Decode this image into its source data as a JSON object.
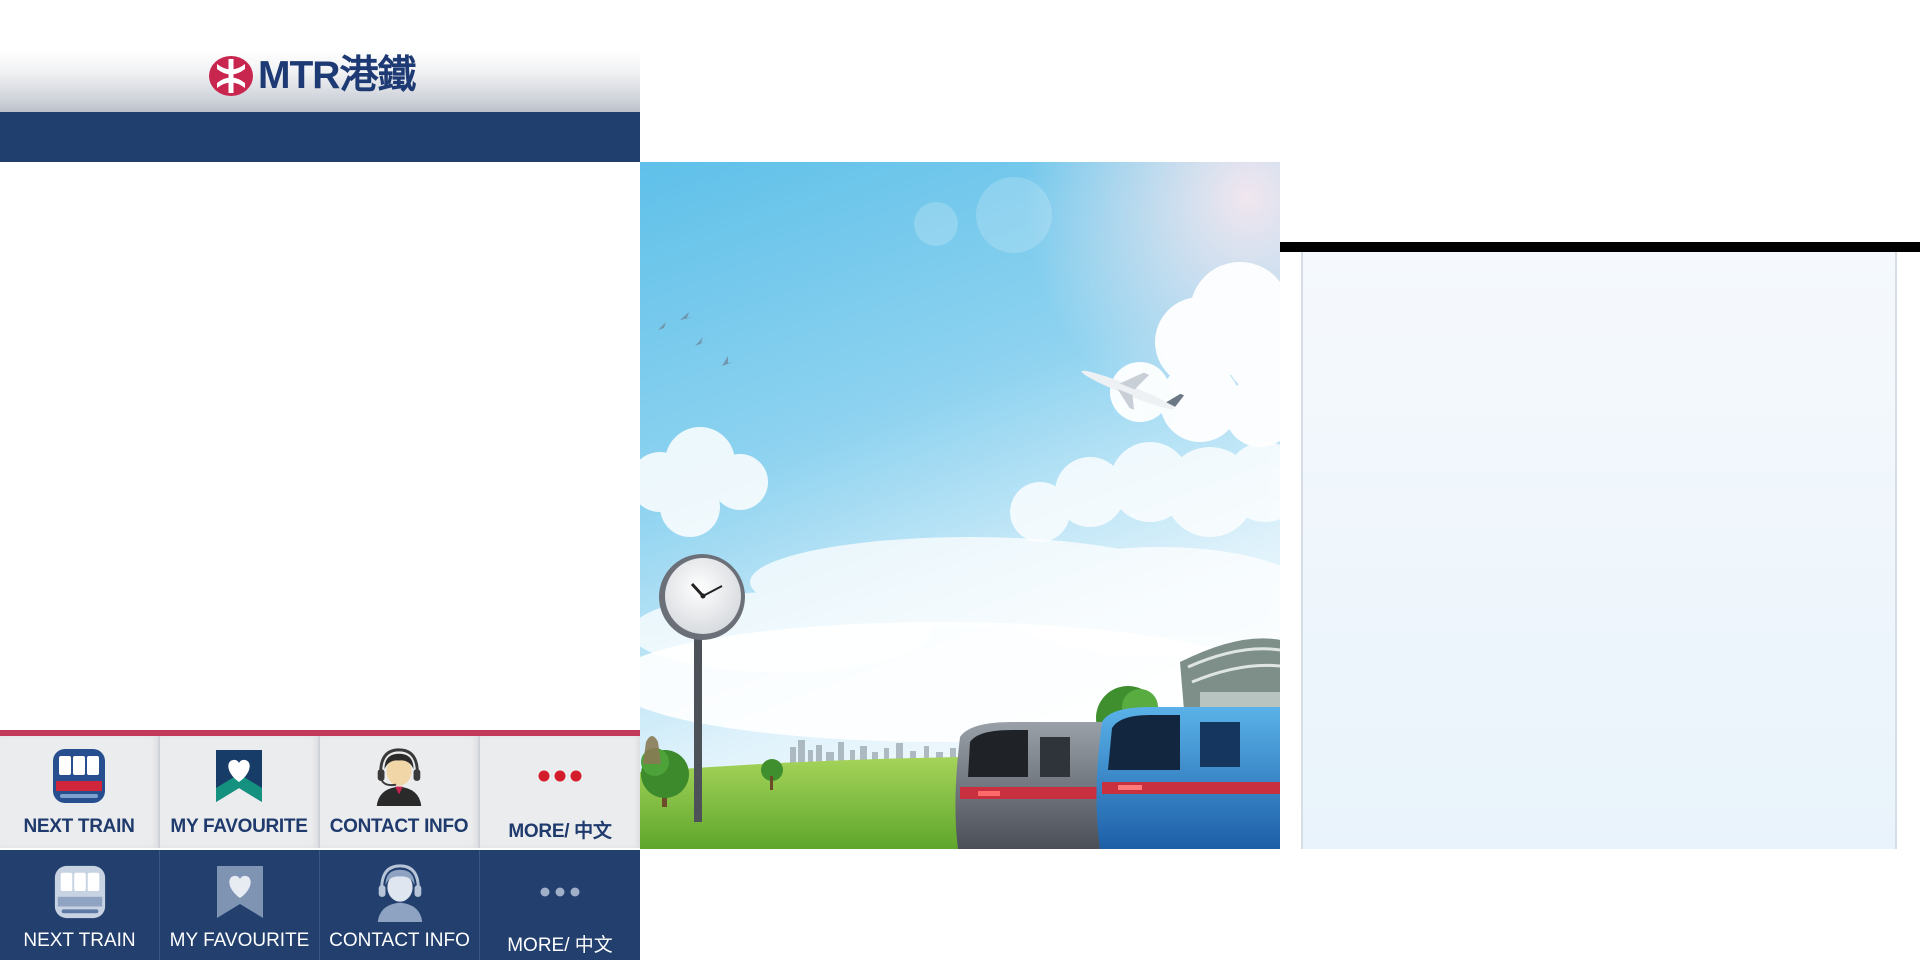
{
  "app": {
    "logo_text": "MTR港鐵",
    "brand_colors": {
      "navy": "#213f6e",
      "red": "#c23a5a",
      "logo_red": "#c8254f"
    }
  },
  "tabs_light": [
    {
      "label": "NEXT TRAIN",
      "icon": "train-icon"
    },
    {
      "label": "MY FAVOURITE",
      "icon": "heart-bookmark-icon"
    },
    {
      "label": "CONTACT INFO",
      "icon": "headset-agent-icon"
    },
    {
      "label": "MORE/ 中文",
      "icon": "more-dots-icon"
    }
  ],
  "tabs_dark": [
    {
      "label": "NEXT TRAIN",
      "icon": "train-icon"
    },
    {
      "label": "MY FAVOURITE",
      "icon": "heart-bookmark-icon"
    },
    {
      "label": "CONTACT INFO",
      "icon": "headset-agent-icon"
    },
    {
      "label": "MORE/ 中文",
      "icon": "more-dots-icon"
    }
  ],
  "hero": {
    "description_icons": [
      "clock-icon",
      "airplane-icon",
      "birds-icon",
      "train-icon"
    ]
  }
}
